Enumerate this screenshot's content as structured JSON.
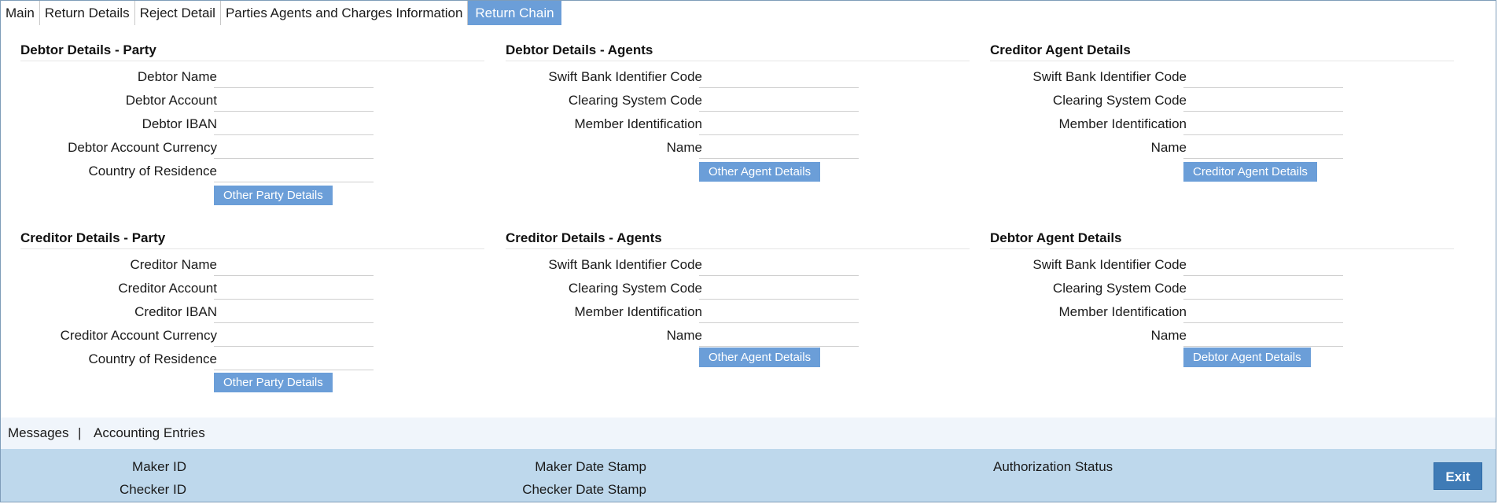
{
  "tabs": [
    {
      "label": "Main"
    },
    {
      "label": "Return Details"
    },
    {
      "label": "Reject Detail"
    },
    {
      "label": "Parties Agents and Charges Information"
    },
    {
      "label": "Return Chain",
      "active": true
    }
  ],
  "sections": {
    "debtor_party": {
      "title": "Debtor Details - Party",
      "fields": [
        "Debtor Name",
        "Debtor Account",
        "Debtor IBAN",
        "Debtor Account Currency",
        "Country of Residence"
      ],
      "button": "Other Party Details"
    },
    "debtor_agents": {
      "title": "Debtor Details - Agents",
      "fields": [
        "Swift Bank Identifier Code",
        "Clearing System Code",
        "Member Identification",
        "Name"
      ],
      "button": "Other Agent Details"
    },
    "creditor_agent": {
      "title": "Creditor Agent Details",
      "fields": [
        "Swift Bank Identifier Code",
        "Clearing System Code",
        "Member Identification",
        "Name"
      ],
      "button": "Creditor Agent Details"
    },
    "creditor_party": {
      "title": "Creditor Details - Party",
      "fields": [
        "Creditor Name",
        "Creditor Account",
        "Creditor IBAN",
        "Creditor Account Currency",
        "Country of Residence"
      ],
      "button": "Other Party Details"
    },
    "creditor_agents": {
      "title": "Creditor Details - Agents",
      "fields": [
        "Swift Bank Identifier Code",
        "Clearing System Code",
        "Member Identification",
        "Name"
      ],
      "button": "Other Agent Details"
    },
    "debtor_agent": {
      "title": "Debtor Agent Details",
      "fields": [
        "Swift Bank Identifier Code",
        "Clearing System Code",
        "Member Identification",
        "Name"
      ],
      "button": "Debtor Agent Details"
    }
  },
  "links": {
    "messages": "Messages",
    "separator": "|",
    "accounting": "Accounting Entries"
  },
  "footer": {
    "maker_id": "Maker ID",
    "checker_id": "Checker ID",
    "maker_date": "Maker Date Stamp",
    "checker_date": "Checker Date Stamp",
    "auth_status": "Authorization Status",
    "exit": "Exit"
  },
  "colors": {
    "accent": "#6b9ed8",
    "footer_bg": "#bed8ec",
    "exit_bg": "#3f7bb6"
  }
}
